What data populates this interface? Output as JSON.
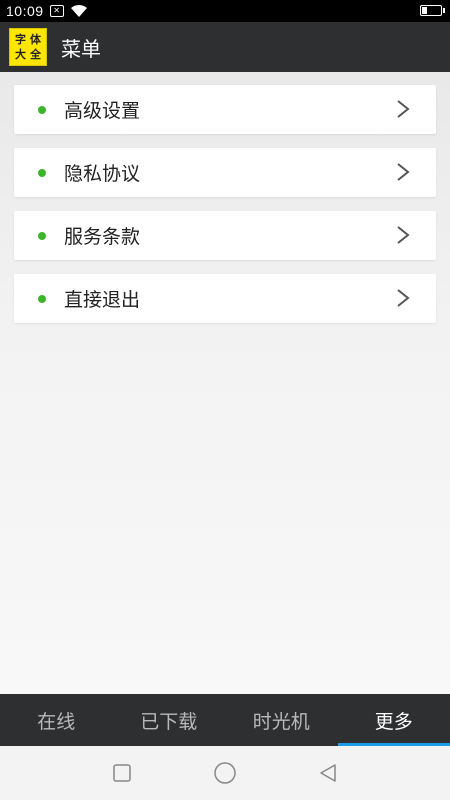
{
  "status_bar": {
    "time": "10:09",
    "notification_glyph": "✕"
  },
  "app_bar": {
    "logo_chars": [
      "字",
      "体",
      "大",
      "全"
    ],
    "title": "菜单"
  },
  "menu": {
    "items": [
      {
        "label": "高级设置"
      },
      {
        "label": "隐私协议"
      },
      {
        "label": "服务条款"
      },
      {
        "label": "直接退出"
      }
    ]
  },
  "tabs": [
    {
      "label": "在线",
      "active": false
    },
    {
      "label": "已下载",
      "active": false
    },
    {
      "label": "时光机",
      "active": false
    },
    {
      "label": "更多",
      "active": true
    }
  ],
  "colors": {
    "bar_bg": "#2d2f31",
    "logo_bg": "#ffe600",
    "dot": "#3cb52b",
    "tab_indicator": "#1e9be8"
  },
  "icons": {
    "menu_chevron": "chevron-right-icon",
    "nav_recent": "square-icon",
    "nav_home": "circle-icon",
    "nav_back": "triangle-back-icon"
  }
}
